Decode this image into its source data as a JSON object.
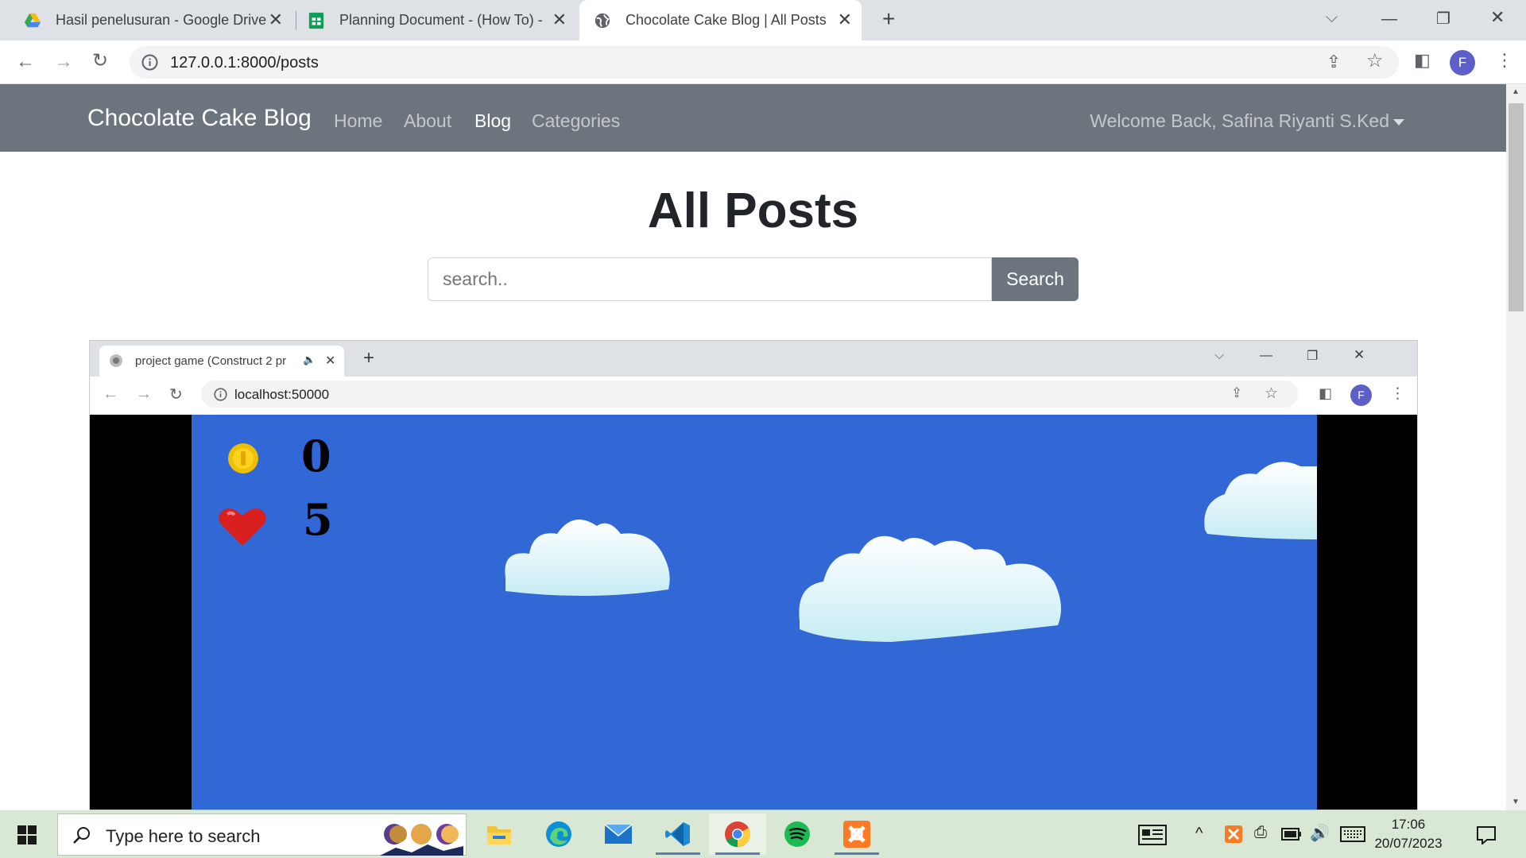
{
  "browser": {
    "tabs": [
      {
        "title": "Hasil penelusuran - Google Drive",
        "icon": "google-drive-icon"
      },
      {
        "title": "Planning Document - (How To) -",
        "icon": "google-sheets-icon"
      },
      {
        "title": "Chocolate Cake Blog | All Posts",
        "icon": "globe-icon",
        "active": true
      }
    ],
    "url": "127.0.0.1:8000/posts",
    "profile_initial": "F"
  },
  "site": {
    "brand": "Chocolate Cake Blog",
    "nav": [
      "Home",
      "About",
      "Blog",
      "Categories"
    ],
    "active_nav": "Blog",
    "welcome": "Welcome Back, Safina Riyanti S.Ked",
    "page_title": "All Posts",
    "search_placeholder": "search..",
    "search_button": "Search"
  },
  "embedded_window": {
    "tab_title": "project game (Construct 2 pr",
    "url": "localhost:50000",
    "profile_initial": "F",
    "game": {
      "coins": "0",
      "lives": "5",
      "background": "#3168d6"
    }
  },
  "taskbar": {
    "search_placeholder": "Type here to search",
    "apps": [
      "file-explorer-icon",
      "edge-icon",
      "mail-icon",
      "vscode-icon",
      "chrome-icon",
      "spotify-icon",
      "xampp-icon"
    ],
    "time": "17:06",
    "date": "20/07/2023"
  }
}
